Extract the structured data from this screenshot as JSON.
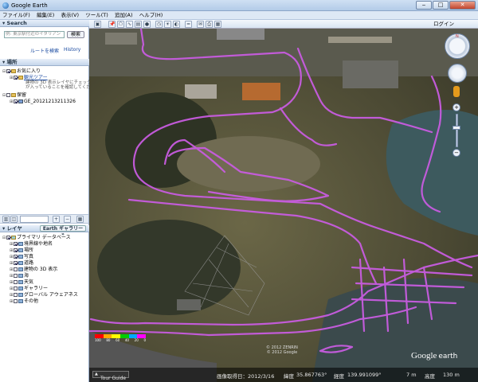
{
  "window": {
    "title": "Google Earth",
    "minimize": "‒",
    "maximize": "□",
    "close": "✕"
  },
  "menu": [
    "ファイル(F)",
    "編集(E)",
    "表示(V)",
    "ツール(T)",
    "追加(A)",
    "ヘルプ(H)"
  ],
  "toolbar": {
    "login": "ログイン"
  },
  "search": {
    "header": "Search",
    "placeholder": "例: 東京駅付近のイタリアン",
    "button": "検索",
    "route_link": "ルートを検索",
    "history_link": "History"
  },
  "places": {
    "header": "場所",
    "favorites": "お気に入り",
    "tour": "観光ツアー",
    "tour_desc1": "建物の 3D 表示レイヤにチェック",
    "tour_desc2": "が入っていることを確認してくだ",
    "saved": "保留",
    "track": "GE_20121213211326"
  },
  "panel_buttons": {
    "add": "+",
    "remove": "−"
  },
  "layers": {
    "header": "レイヤ",
    "gallery": "Earth ギャラリー",
    "gallery_arrow": "»",
    "primary": "プライマリ データベース",
    "items": [
      {
        "label": "境界線や地名",
        "checked": true
      },
      {
        "label": "場所",
        "checked": true
      },
      {
        "label": "写真",
        "checked": true
      },
      {
        "label": "道路",
        "checked": true
      },
      {
        "label": "建物の 3D 表示",
        "checked": false
      },
      {
        "label": "海",
        "checked": false
      },
      {
        "label": "天気",
        "checked": false
      },
      {
        "label": "ギャラリー",
        "checked": false
      },
      {
        "label": "グローバル アウェアネス",
        "checked": false
      },
      {
        "label": "その他",
        "checked": false
      }
    ]
  },
  "legend": {
    "labels": [
      "100",
      "80",
      "60",
      "40",
      "20",
      "0"
    ],
    "colors": [
      "#ff0000",
      "#ffaa00",
      "#ffff00",
      "#00cc00",
      "#00aaff",
      "#ff00ff"
    ]
  },
  "copyright": {
    "line1": "© 2012 ZENRIN",
    "line2": "© 2012 Google"
  },
  "status": {
    "tour_guide": "Tour Guide",
    "imagery_date": "画像取得日：2012/3/16",
    "lat_label": "緯度",
    "lat": "35.867763°",
    "lon_label": "経度",
    "lon": "139.991099°",
    "elev": "7 m",
    "alt_label": "高度",
    "alt": "130 m"
  },
  "brand": {
    "google": "Google",
    "earth": "earth"
  },
  "colors": {
    "track": "#c85ce0",
    "water": "#3d5a5e",
    "grass": "#4e4d34"
  }
}
